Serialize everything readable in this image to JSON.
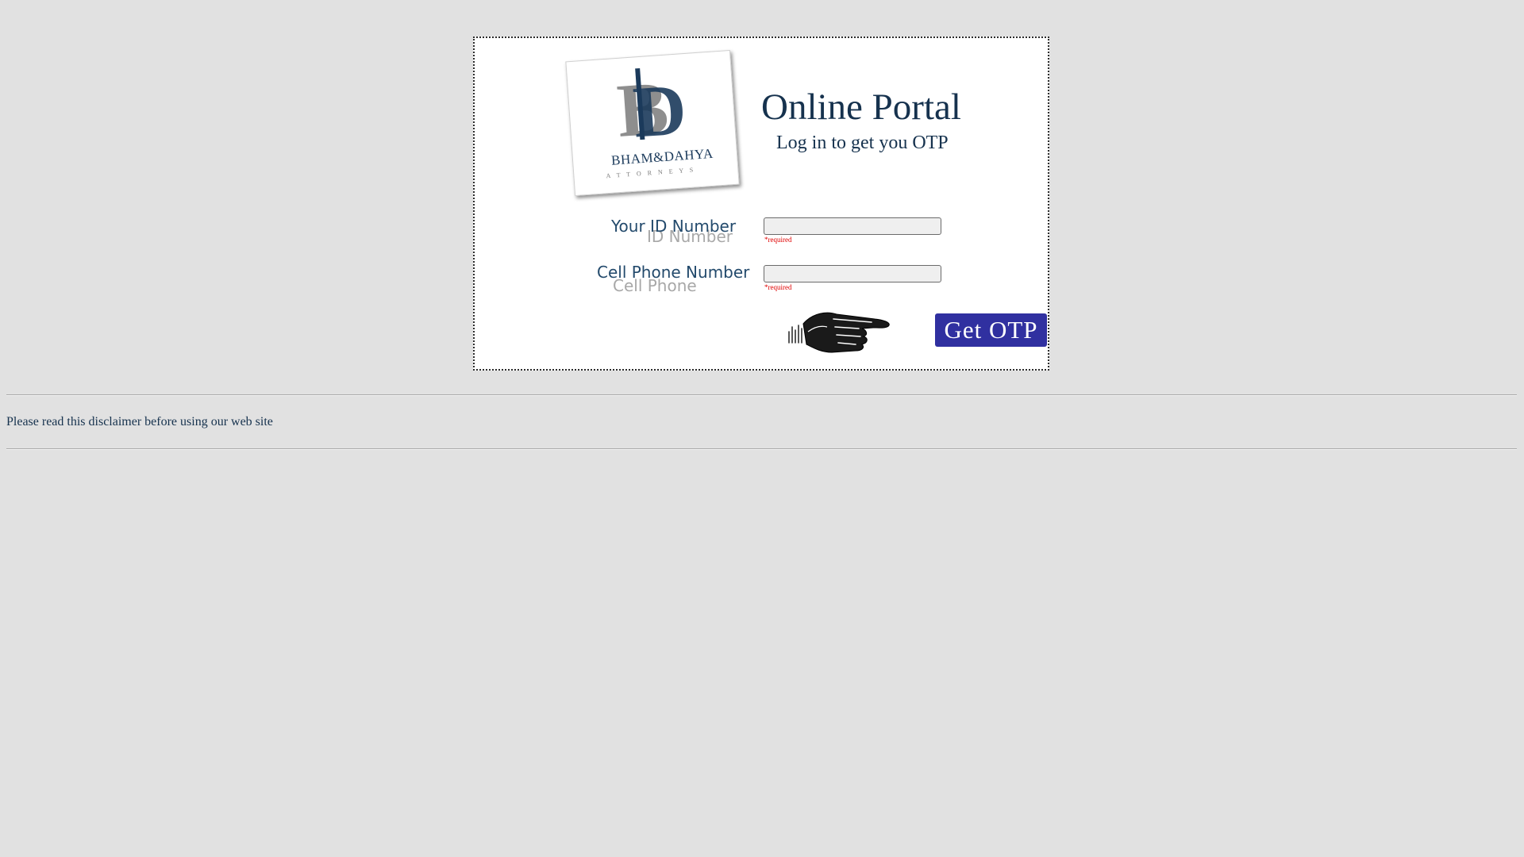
{
  "header": {
    "title": "Online Portal",
    "subtitle": "Log in to get you OTP"
  },
  "logo": {
    "initials": "BD",
    "firm_name": "BHAM&DAHYA",
    "tagline": "A T T O R N E Y S"
  },
  "form": {
    "id_field": {
      "label": "Your ID Number",
      "label_ghost": "ID Number",
      "value": "",
      "required_note": "*required"
    },
    "phone_field": {
      "label": "Cell Phone Number",
      "label_ghost": "Cell Phone",
      "value": "",
      "required_note": "*required"
    },
    "submit_label": "Get OTP"
  },
  "footer": {
    "disclaimer_text": "Please read this disclaimer before using our web site"
  },
  "colors": {
    "page_background": "#e1e1e1",
    "title_text": "#16324e",
    "button_background": "#3030a0",
    "required_text": "#e00000"
  },
  "icons": {
    "pointer": "pointing-hand-icon",
    "logo": "law-firm-logo"
  }
}
